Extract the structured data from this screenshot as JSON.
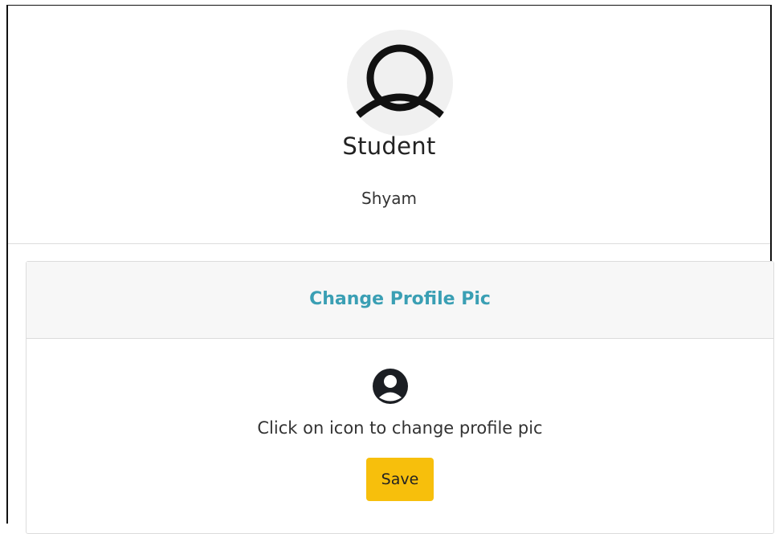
{
  "profile": {
    "avatar_icon": "user-outline-icon",
    "role": "Student",
    "name": "Shyam"
  },
  "change_pic_card": {
    "title": "Change Profile Pic",
    "icon": "user-circle-icon",
    "hint": "Click on icon to change profile pic",
    "save_label": "Save"
  },
  "colors": {
    "accent_title": "#3a9fb4",
    "save_button": "#f7bf0c",
    "avatar_background": "#f0f0f0"
  }
}
